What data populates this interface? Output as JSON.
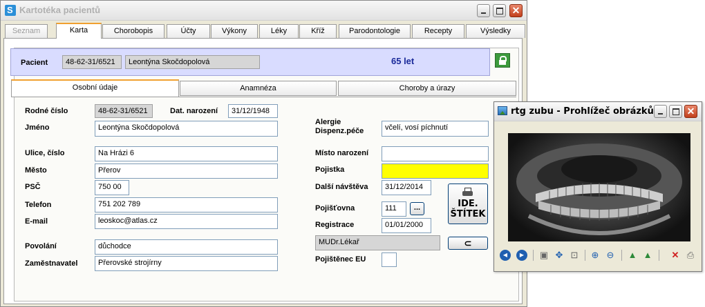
{
  "window": {
    "title": "Kartotéka pacientů"
  },
  "tabs": [
    {
      "label": "Seznam",
      "state": "disabled"
    },
    {
      "label": "Karta",
      "state": "active"
    },
    {
      "label": "Chorobopis",
      "state": "normal"
    },
    {
      "label": "Účty",
      "state": "normal"
    },
    {
      "label": "Výkony",
      "state": "normal"
    },
    {
      "label": "Léky",
      "state": "normal"
    },
    {
      "label": "Kříž",
      "state": "normal"
    },
    {
      "label": "Parodontologie",
      "state": "normal"
    },
    {
      "label": "Recepty",
      "state": "normal"
    },
    {
      "label": "Výsledky",
      "state": "normal"
    }
  ],
  "patient": {
    "label": "Pacient",
    "id": "48-62-31/6521",
    "name": "Leontýna Skočdopolová",
    "age": "65 let"
  },
  "subtabs": [
    {
      "label": "Osobní údaje",
      "state": "active"
    },
    {
      "label": "Anamnéza",
      "state": "normal"
    },
    {
      "label": "Choroby a úrazy",
      "state": "normal"
    }
  ],
  "form": {
    "rodne_cislo": {
      "label": "Rodné číslo",
      "value": "48-62-31/6521"
    },
    "dat_narozeni": {
      "label": "Dat. narození",
      "value": "31/12/1948"
    },
    "jmeno": {
      "label": "Jméno",
      "value": "Leontýna Skočdopolová"
    },
    "ulice": {
      "label": "Ulice, číslo",
      "value": "Na Hrázi 6"
    },
    "mesto": {
      "label": "Město",
      "value": "Přerov"
    },
    "psc": {
      "label": "PSČ",
      "value": "750 00"
    },
    "telefon": {
      "label": "Telefon",
      "value": "751 202 789"
    },
    "email": {
      "label": "E-mail",
      "value": "leoskoc@atlas.cz"
    },
    "povolani": {
      "label": "Povolání",
      "value": "důchodce"
    },
    "zamestnavatel": {
      "label": "Zaměstnavatel",
      "value": "Přerovské strojírny"
    },
    "alergie": {
      "label_1": "Alergie",
      "label_2": "Dispenz.péče",
      "value": "včelí, vosí píchnutí"
    },
    "misto_narozeni": {
      "label": "Místo narození",
      "value": ""
    },
    "pojistka": {
      "label": "Pojistka",
      "value": ""
    },
    "dalsi_navsteva": {
      "label": "Další návštěva",
      "value": "31/12/2014"
    },
    "pojistovna": {
      "label": "Pojišťovna",
      "value": "111",
      "button": "..."
    },
    "registrace": {
      "label": "Registrace",
      "value": "01/01/2000"
    },
    "lekar": {
      "value": "MUDr.Lékař"
    },
    "pojistenec_eu": {
      "label": "Pojištěnec EU"
    }
  },
  "buttons": {
    "ide_line1": "IDE.",
    "ide_line2": "ŠTÍTEK",
    "back_glyph": "⊂"
  },
  "viewer": {
    "title": "rtg zubu - Prohlížeč obrázků ...",
    "toolbar": [
      {
        "icon": "previous-icon",
        "glyph": "◀"
      },
      {
        "icon": "next-icon",
        "glyph": "▶"
      },
      {
        "icon": "fit-icon",
        "glyph": "▣"
      },
      {
        "icon": "move-icon",
        "glyph": "✥"
      },
      {
        "icon": "actual-size-icon",
        "glyph": "⊡"
      },
      {
        "icon": "zoom-in-icon",
        "glyph": "⊕"
      },
      {
        "icon": "zoom-out-icon",
        "glyph": "⊖"
      },
      {
        "icon": "rotate-left-icon",
        "glyph": "▲"
      },
      {
        "icon": "rotate-right-icon",
        "glyph": "▲"
      },
      {
        "icon": "delete-icon",
        "glyph": "✕"
      },
      {
        "icon": "print-icon",
        "glyph": "⎙"
      }
    ]
  }
}
